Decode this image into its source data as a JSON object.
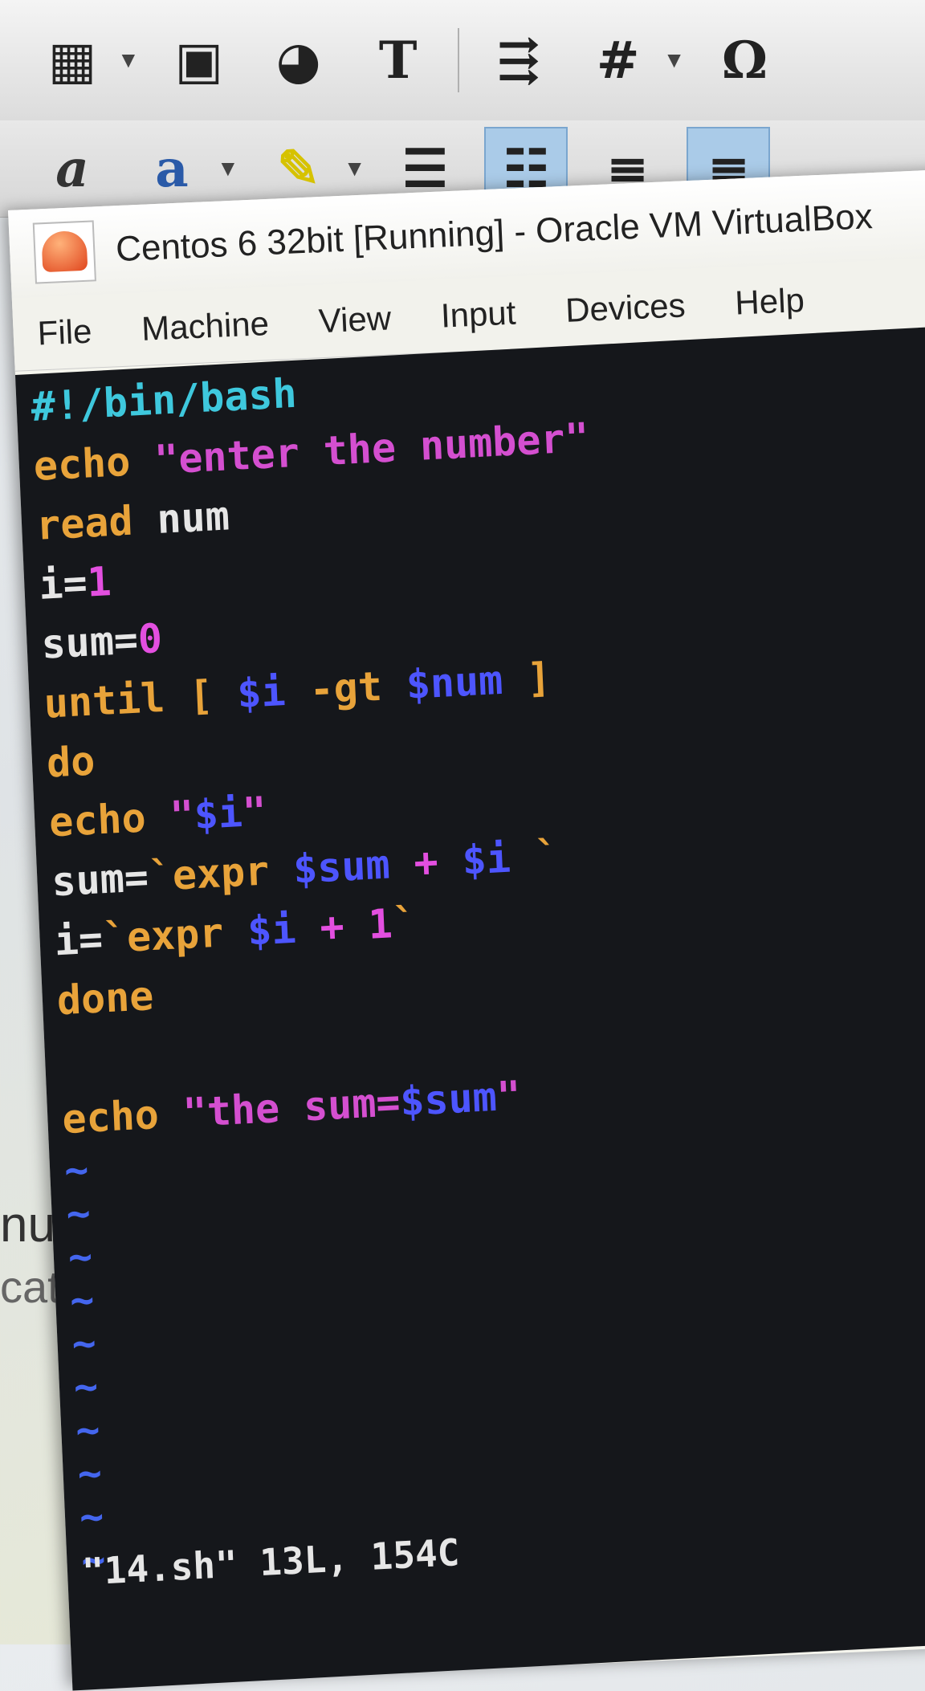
{
  "toolbar1": {
    "items": [
      {
        "icon": "table-icon",
        "glyph": "▦"
      },
      {
        "icon": "image-icon",
        "glyph": "▣"
      },
      {
        "icon": "chart-icon",
        "glyph": "◕"
      },
      {
        "icon": "text-box-icon",
        "glyph": "T"
      },
      {
        "icon": "page-break-icon",
        "glyph": "⇶"
      },
      {
        "icon": "field-icon",
        "glyph": "#"
      },
      {
        "icon": "special-character-icon",
        "glyph": "Ω"
      }
    ]
  },
  "toolbar2": {
    "items": [
      {
        "icon": "font-color-icon",
        "glyph": "a"
      },
      {
        "icon": "character-highlight-icon",
        "glyph": "a"
      },
      {
        "icon": "highlighter-icon",
        "glyph": "✎"
      },
      {
        "icon": "bullet-list-icon",
        "glyph": "☰"
      },
      {
        "icon": "numbered-list-icon",
        "glyph": "☷"
      },
      {
        "icon": "align-left-icon",
        "glyph": "≡"
      },
      {
        "icon": "align-center-icon",
        "glyph": "≡"
      }
    ]
  },
  "background_document": {
    "line1": "numb",
    "line2": "cat >"
  },
  "window": {
    "title": "Centos 6 32bit [Running] - Oracle VM VirtualBox",
    "menu": [
      "File",
      "Machine",
      "View",
      "Input",
      "Devices",
      "Help"
    ]
  },
  "terminal": {
    "lines": [
      "#!/bin/bash",
      "echo \"enter the number\"",
      "read num",
      "i=1",
      "sum=0",
      "until [ $i -gt $num ]",
      "do",
      "echo \"$i\"",
      "sum=`expr $sum + $i `",
      "i=`expr $i + 1`",
      "done",
      "",
      "echo \"the sum=$sum\""
    ],
    "empty_line_marker": "~",
    "status": "\"14.sh\" 13L, 154C",
    "colors": {
      "background": "#15171b",
      "keyword": "#e8a33a",
      "string": "#d44fd0",
      "variable": "#4d55ff",
      "number": "#e34fe0",
      "shebang": "#3ec8dd"
    }
  }
}
